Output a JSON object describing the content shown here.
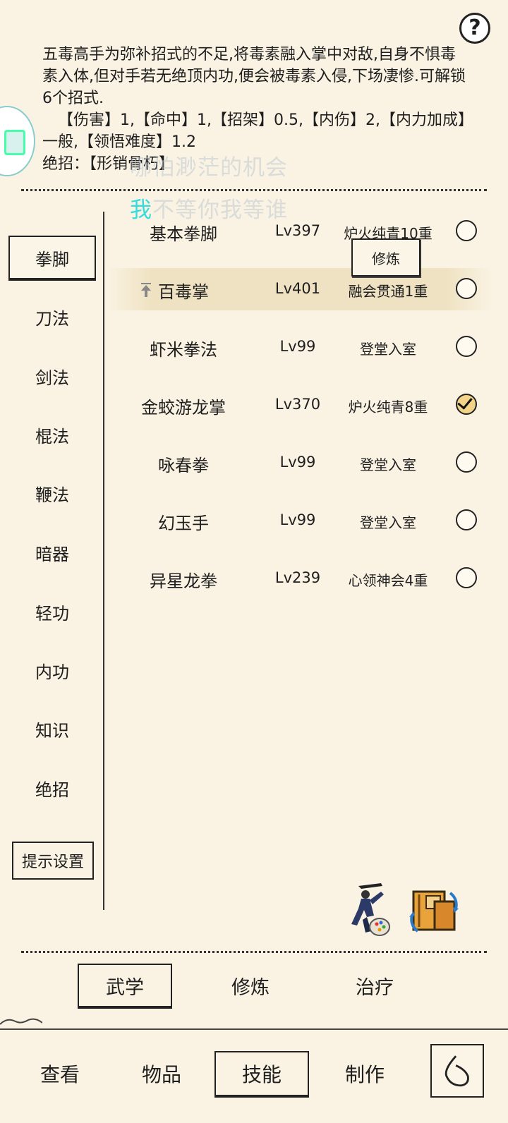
{
  "help": {
    "glyph": "?"
  },
  "description": {
    "text": "五毒高手为弥补招式的不足,将毒素融入掌中对敌,自身不惧毒素入体,但对手若无绝顶内功,便会被毒素入侵,下场凄惨.可解锁6个招式.",
    "stats": "【伤害】1,【命中】1,【招架】0.5,【内伤】2,【内力加成】一般,【领悟难度】1.2",
    "ultimate_label": "绝招：",
    "ultimate_value": "【形销骨朽】"
  },
  "watermark": {
    "line1": "哪怕渺茫的机会",
    "line2_first": "我",
    "line2_rest": "不等你我等谁"
  },
  "sidebar": {
    "items": [
      {
        "label": "拳脚",
        "active": true
      },
      {
        "label": "刀法"
      },
      {
        "label": "剑法"
      },
      {
        "label": "棍法"
      },
      {
        "label": "鞭法"
      },
      {
        "label": "暗器"
      },
      {
        "label": "轻功"
      },
      {
        "label": "内功"
      },
      {
        "label": "知识"
      },
      {
        "label": "绝招"
      }
    ],
    "hint_settings": "提示设置"
  },
  "skills": [
    {
      "name": "基本拳脚",
      "level": "Lv397",
      "rank": "炉火纯青10重",
      "checked": false
    },
    {
      "name": "百毒掌",
      "level": "Lv401",
      "rank": "融会贯通1重",
      "checked": false,
      "selected": true
    },
    {
      "name": "虾米拳法",
      "level": "Lv99",
      "rank": "登堂入室",
      "checked": false
    },
    {
      "name": "金蛟游龙掌",
      "level": "Lv370",
      "rank": "炉火纯青8重",
      "checked": true
    },
    {
      "name": "咏春拳",
      "level": "Lv99",
      "rank": "登堂入室",
      "checked": false
    },
    {
      "name": "幻玉手",
      "level": "Lv99",
      "rank": "登堂入室",
      "checked": false
    },
    {
      "name": "异星龙拳",
      "level": "Lv239",
      "rank": "心领神会4重",
      "checked": false
    }
  ],
  "train_button": "修炼",
  "sub_tabs": [
    {
      "label": "武学",
      "active": true
    },
    {
      "label": "修炼"
    },
    {
      "label": "治疗"
    }
  ],
  "nav": [
    {
      "label": "查看"
    },
    {
      "label": "物品"
    },
    {
      "label": "技能",
      "active": true
    },
    {
      "label": "制作"
    }
  ],
  "icons": {
    "help": "question-icon",
    "back": "back-icon",
    "fighter": "martial-artist-icon",
    "book": "manual-swap-icon"
  }
}
